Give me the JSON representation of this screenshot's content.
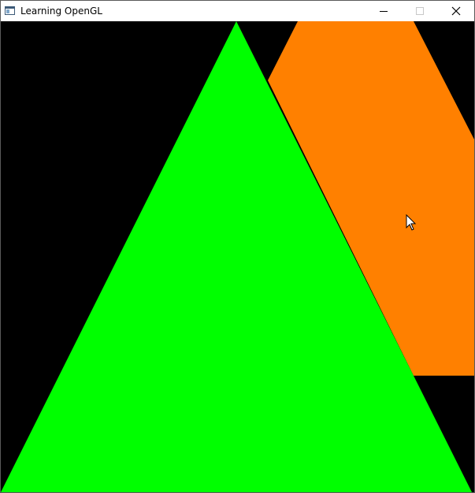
{
  "window": {
    "title": "Learning OpenGL",
    "icon": "opengl-app-icon",
    "controls": {
      "minimize": "minimize-icon",
      "maximize": "maximize-icon",
      "close": "close-icon"
    }
  },
  "canvas": {
    "clear_color": "#000000",
    "shapes": [
      {
        "name": "orange-hexagon",
        "color": "#ff8000"
      },
      {
        "name": "green-triangle",
        "color": "#00ff00"
      }
    ]
  },
  "cursor": {
    "icon": "arrow-cursor-icon"
  }
}
